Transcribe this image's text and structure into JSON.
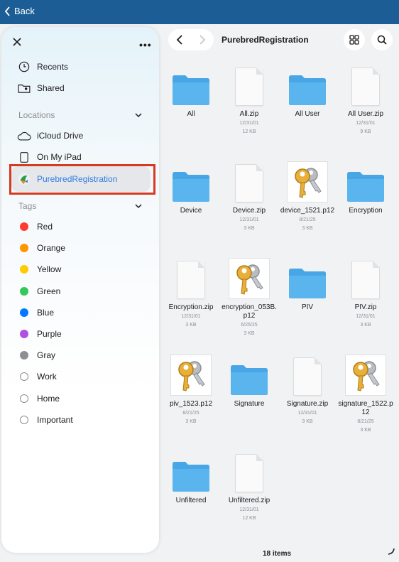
{
  "topbar": {
    "back_label": "Back"
  },
  "sidebar": {
    "top_items": [
      {
        "label": "Recents",
        "icon": "clock-icon"
      },
      {
        "label": "Shared",
        "icon": "shared-folder-icon"
      }
    ],
    "locations_header": "Locations",
    "locations": [
      {
        "label": "iCloud Drive",
        "icon": "cloud-icon"
      },
      {
        "label": "On My iPad",
        "icon": "ipad-icon"
      },
      {
        "label": "PurebredRegistration",
        "icon": "app-icon",
        "selected": true
      }
    ],
    "tags_header": "Tags",
    "tags": [
      {
        "label": "Red",
        "color": "#ff3b30"
      },
      {
        "label": "Orange",
        "color": "#ff9500"
      },
      {
        "label": "Yellow",
        "color": "#ffcc00"
      },
      {
        "label": "Green",
        "color": "#34c759"
      },
      {
        "label": "Blue",
        "color": "#007aff"
      },
      {
        "label": "Purple",
        "color": "#af52de"
      },
      {
        "label": "Gray",
        "color": "#8e8e93"
      },
      {
        "label": "Work",
        "color": ""
      },
      {
        "label": "Home",
        "color": ""
      },
      {
        "label": "Important",
        "color": ""
      }
    ]
  },
  "header": {
    "title": "PurebredRegistration"
  },
  "files": [
    {
      "name": "All",
      "type": "folder",
      "date": "",
      "size": ""
    },
    {
      "name": "All.zip",
      "type": "zip",
      "date": "12/31/01",
      "size": "12 KB"
    },
    {
      "name": "All User",
      "type": "folder",
      "date": "",
      "size": ""
    },
    {
      "name": "All User.zip",
      "type": "zip",
      "date": "12/31/01",
      "size": "9 KB"
    },
    {
      "name": "Device",
      "type": "folder",
      "date": "",
      "size": ""
    },
    {
      "name": "Device.zip",
      "type": "zip",
      "date": "12/31/01",
      "size": "3 KB"
    },
    {
      "name": "device_1521.p12",
      "type": "key",
      "date": "8/21/25",
      "size": "3 KB"
    },
    {
      "name": "Encryption",
      "type": "folder",
      "date": "",
      "size": ""
    },
    {
      "name": "Encryption.zip",
      "type": "zip",
      "date": "12/31/01",
      "size": "3 KB"
    },
    {
      "name": "encryption_053B.p12",
      "type": "key",
      "date": "6/25/25",
      "size": "3 KB"
    },
    {
      "name": "PIV",
      "type": "folder",
      "date": "",
      "size": ""
    },
    {
      "name": "PIV.zip",
      "type": "zip",
      "date": "12/31/01",
      "size": "3 KB"
    },
    {
      "name": "piv_1523.p12",
      "type": "key",
      "date": "8/21/25",
      "size": "3 KB"
    },
    {
      "name": "Signature",
      "type": "folder",
      "date": "",
      "size": ""
    },
    {
      "name": "Signature.zip",
      "type": "zip",
      "date": "12/31/01",
      "size": "3 KB"
    },
    {
      "name": "signature_1522.p12",
      "type": "key",
      "date": "8/21/25",
      "size": "3 KB"
    },
    {
      "name": "Unfiltered",
      "type": "folder",
      "date": "",
      "size": ""
    },
    {
      "name": "Unfiltered.zip",
      "type": "zip",
      "date": "12/31/01",
      "size": "12 KB"
    }
  ],
  "footer": {
    "item_count": "18 items"
  }
}
